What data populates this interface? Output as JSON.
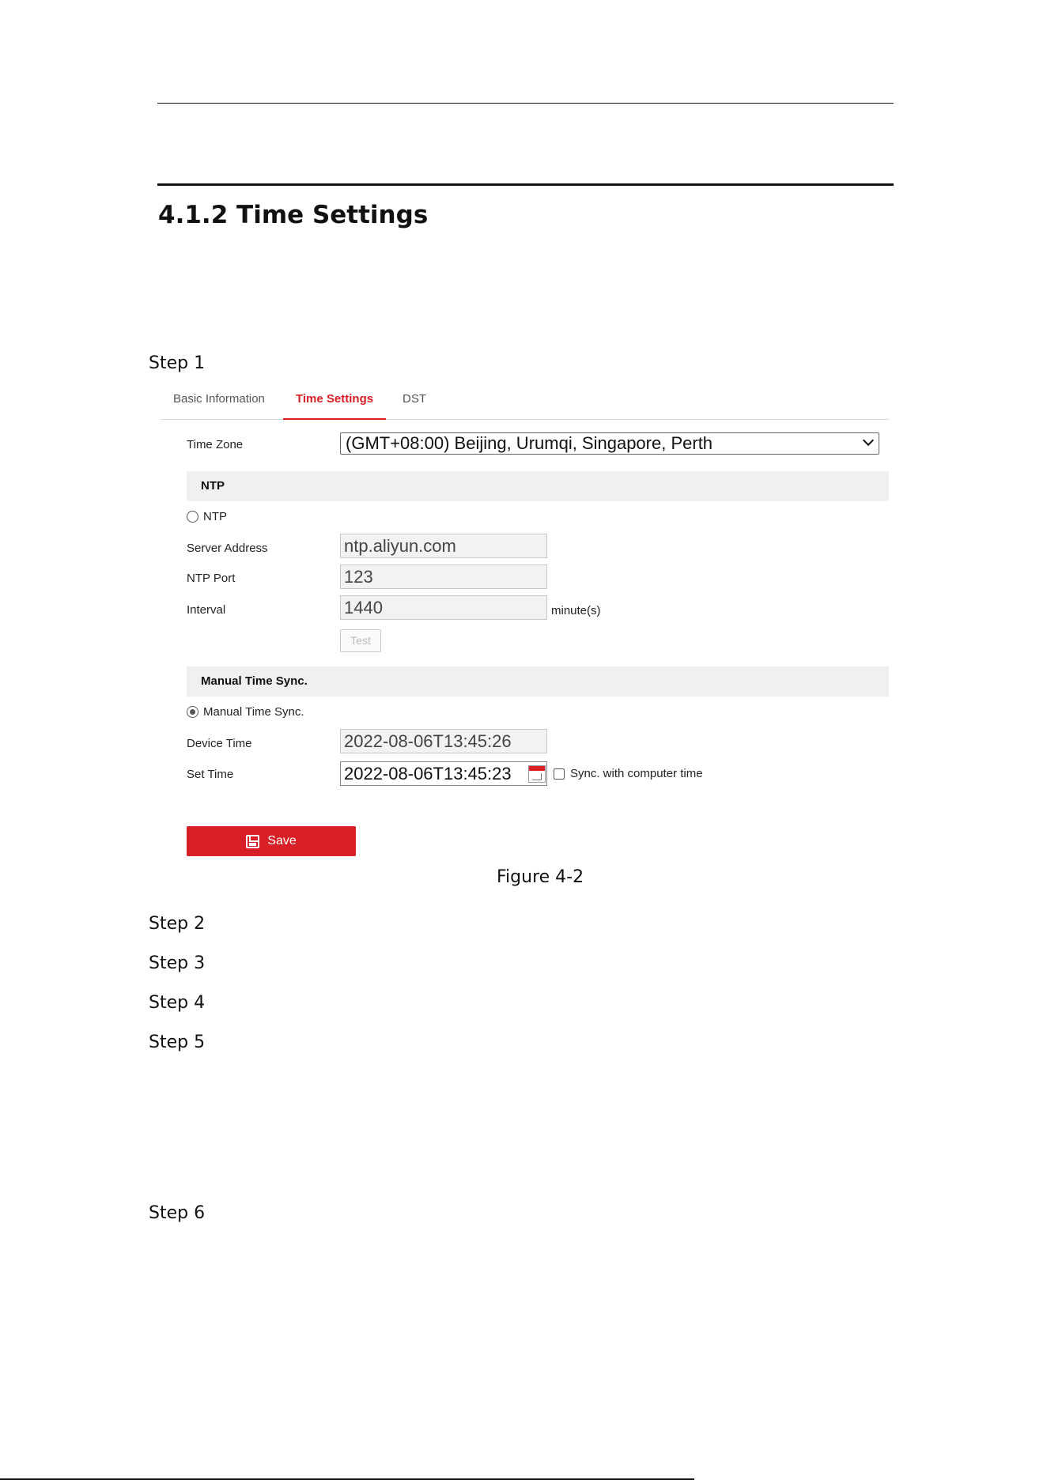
{
  "document": {
    "section_title": "4.1.2 Time Settings",
    "figure_caption": "Figure 4-2",
    "steps": [
      "Step 1",
      "Step 2",
      "Step 3",
      "Step 4",
      "Step 5",
      "Step 6"
    ]
  },
  "ui": {
    "tabs": [
      {
        "label": "Basic Information",
        "active": false
      },
      {
        "label": "Time Settings",
        "active": true
      },
      {
        "label": "DST",
        "active": false
      }
    ],
    "time_zone": {
      "label": "Time Zone",
      "value": "(GMT+08:00) Beijing, Urumqi, Singapore, Perth"
    },
    "ntp": {
      "section_title": "NTP",
      "radio_label": "NTP",
      "selected": false,
      "server_address_label": "Server Address",
      "server_address": "ntp.aliyun.com",
      "port_label": "NTP Port",
      "port": "123",
      "interval_label": "Interval",
      "interval": "1440",
      "interval_unit": "minute(s)",
      "test_label": "Test"
    },
    "manual": {
      "section_title": "Manual Time Sync.",
      "radio_label": "Manual Time Sync.",
      "selected": true,
      "device_time_label": "Device Time",
      "device_time": "2022-08-06T13:45:26",
      "set_time_label": "Set Time",
      "set_time": "2022-08-06T13:45:23",
      "sync_label": "Sync. with computer time",
      "sync_checked": false
    },
    "save_label": "Save",
    "colors": {
      "accent": "#d81f26",
      "band": "#f0f0f0"
    }
  }
}
